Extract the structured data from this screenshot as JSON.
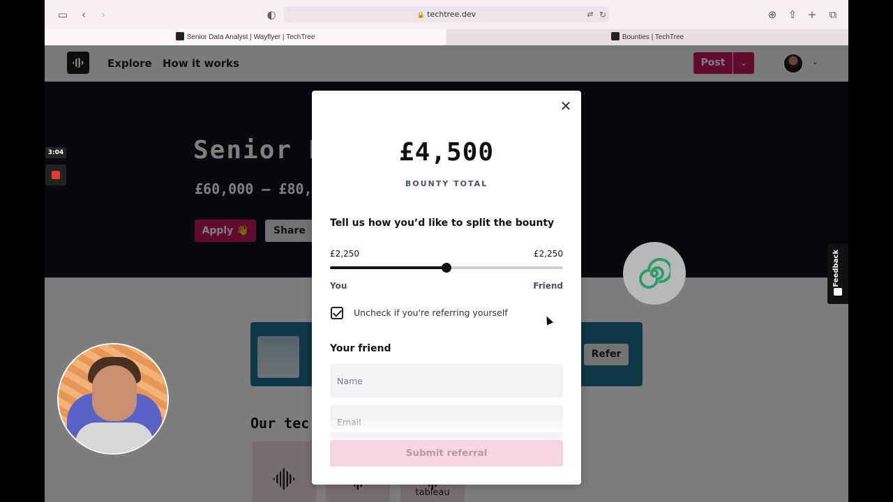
{
  "browser": {
    "url": "techtree.dev",
    "tabs": [
      {
        "label": "Senior Data Analyst | Wayflyer | TechTree"
      },
      {
        "label": "Bounties | TechTree"
      }
    ]
  },
  "header": {
    "nav": [
      "Explore",
      "How it works"
    ],
    "post_label": "Post"
  },
  "hero": {
    "title": "Senior D",
    "salary": "£60,000 – £80,",
    "apply_label": "Apply 👋",
    "share_label": "Share"
  },
  "page": {
    "refer_label": "Refer",
    "tech_title": "Our tec",
    "tech_tiles": [
      "",
      "",
      "tableau"
    ]
  },
  "recording": {
    "timer": "3:04"
  },
  "feedback": {
    "label": "Feedback"
  },
  "modal": {
    "amount": "£4,500",
    "amount_label": "BOUNTY TOTAL",
    "split_title": "Tell us how you’d like to split the bounty",
    "left_value": "£2,250",
    "right_value": "£2,250",
    "split_fraction": 0.5,
    "you_label": "You",
    "friend_label": "Friend",
    "checkbox_label": "Uncheck if you're referring yourself",
    "checkbox_checked": true,
    "friend_title": "Your friend",
    "name_placeholder": "Name",
    "email_placeholder": "Email",
    "submit_label": "Submit referral"
  },
  "colors": {
    "brand": "#c2185b",
    "hero_bg": "#0e1218",
    "submit_disabled": "#f8d5e2"
  }
}
